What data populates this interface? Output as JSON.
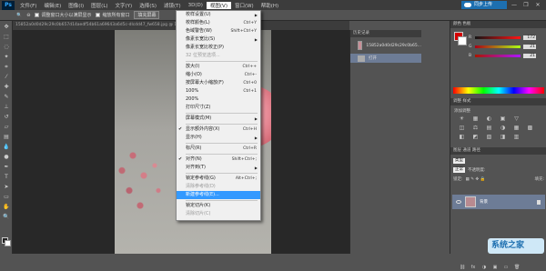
{
  "menubar": {
    "logo": "Ps",
    "items": [
      "文件(F)",
      "编辑(E)",
      "图像(I)",
      "图层(L)",
      "文字(Y)",
      "选择(S)",
      "滤镜(T)",
      "3D(D)",
      "视图(V)",
      "窗口(W)",
      "帮助(H)"
    ],
    "active_index": 8,
    "cloud_button": "同步上传",
    "window_controls": [
      "—",
      "❐",
      "✕"
    ]
  },
  "optbar": {
    "zoom_label": "调整窗口大小以满屏显示",
    "scrubby": "缩放所有窗口",
    "fill_screen_btn": "填充屏幕",
    "print_btn": "打印尺寸",
    "fit_btn": "适合屏幕",
    "full_btn": "填充屏幕"
  },
  "document": {
    "tab_title": "15852a0d0d29c29c0b657d14aedf54b61a69643a6d5c-dlcdd47_fw658.jpg @ 100%(RGB/8#)"
  },
  "view_menu": {
    "items": [
      {
        "label": "校样设置(U)",
        "shortcut": "",
        "arrow": true
      },
      {
        "label": "校样颜色(L)",
        "shortcut": "Ctrl+Y"
      },
      {
        "label": "色域警告(W)",
        "shortcut": "Shift+Ctrl+Y"
      },
      {
        "label": "像素长宽比(S)",
        "shortcut": "",
        "arrow": true
      },
      {
        "label": "像素长宽比校正(P)",
        "shortcut": ""
      },
      {
        "label": "32 位预览选项...",
        "shortcut": "",
        "disabled": true
      },
      {
        "sep": true
      },
      {
        "label": "放大(I)",
        "shortcut": "Ctrl++"
      },
      {
        "label": "缩小(O)",
        "shortcut": "Ctrl+-"
      },
      {
        "label": "按屏幕大小缩放(F)",
        "shortcut": "Ctrl+0"
      },
      {
        "label": "100%",
        "shortcut": "Ctrl+1"
      },
      {
        "label": "200%",
        "shortcut": ""
      },
      {
        "label": "打印尺寸(Z)",
        "shortcut": ""
      },
      {
        "sep": true
      },
      {
        "label": "屏幕模式(M)",
        "shortcut": "",
        "arrow": true
      },
      {
        "sep": true
      },
      {
        "label": "显示额外内容(X)",
        "shortcut": "Ctrl+H",
        "checked": true
      },
      {
        "label": "显示(H)",
        "shortcut": "",
        "arrow": true
      },
      {
        "sep": true
      },
      {
        "label": "标尺(R)",
        "shortcut": "Ctrl+R"
      },
      {
        "sep": true
      },
      {
        "label": "对齐(N)",
        "shortcut": "Shift+Ctrl+;",
        "checked": true
      },
      {
        "label": "对齐到(T)",
        "shortcut": "",
        "arrow": true
      },
      {
        "sep": true
      },
      {
        "label": "锁定参考线(G)",
        "shortcut": "Alt+Ctrl+;"
      },
      {
        "label": "清除参考线(D)",
        "shortcut": "",
        "disabled": true
      },
      {
        "label": "新建参考线(E)...",
        "shortcut": "",
        "highlight": true
      },
      {
        "sep": true
      },
      {
        "label": "锁定切片(K)",
        "shortcut": ""
      },
      {
        "label": "清除切片(C)",
        "shortcut": "",
        "disabled": true
      }
    ]
  },
  "history": {
    "header": "历史记录",
    "snapshot": "15852a0d0d29c29c0b65...",
    "step": "打开"
  },
  "color_panel": {
    "tab": "颜色  色板",
    "fg_color": "#d40000",
    "sliders": [
      {
        "label": "R",
        "value": "172"
      },
      {
        "label": "G",
        "value": "21"
      },
      {
        "label": "B",
        "value": "21"
      }
    ]
  },
  "adjustments": {
    "tab": "调整  样式",
    "title": "添加调整",
    "row1": [
      "☀",
      "▦",
      "◐",
      "▣",
      "▽"
    ],
    "row2": [
      "◫",
      "⚖",
      "▤",
      "◑",
      "▦",
      "▩"
    ],
    "row3": [
      "◧",
      "◩",
      "▧",
      "◨",
      "▥"
    ]
  },
  "layers": {
    "tab": "图层  通道  路径",
    "kind_label": "类型",
    "blend_mode": "正常",
    "opacity_label": "不透明度:",
    "lock_label": "锁定:",
    "fill_label": "填充:",
    "layer_name": "背景",
    "bottom_icons": [
      "⛓",
      "fx",
      "◑",
      "▣",
      "▭",
      "🗑"
    ]
  },
  "watermark": "系统之家"
}
